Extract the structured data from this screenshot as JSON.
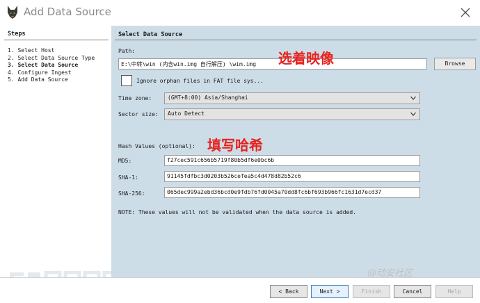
{
  "window": {
    "title": "Add Data Source",
    "close_icon": "close-icon",
    "app_icon": "autopsy-dog-icon"
  },
  "steps": {
    "title": "Steps",
    "items": [
      {
        "label": "1.  Select Host",
        "current": false
      },
      {
        "label": "2.  Select Data Source Type",
        "current": false
      },
      {
        "label": "3.  Select Data Source",
        "current": true
      },
      {
        "label": "4.  Configure Ingest",
        "current": false
      },
      {
        "label": "5.  Add Data Source",
        "current": false
      }
    ]
  },
  "main": {
    "title": "Select Data Source",
    "path_label": "Path:",
    "path_value": "E:\\中转\\win (内含win.img 自行解压) \\wim.img",
    "browse_label": "Browse",
    "ignore_orphan_label": "Ignore orphan files in FAT file sys...",
    "ignore_orphan_checked": false,
    "timezone_label": "Time zone:",
    "timezone_value": "(GMT+8:00) Asia/Shanghai",
    "sector_label": "Sector size:",
    "sector_value": "Auto Detect",
    "hash_label": "Hash Values (optional):",
    "md5_label": "MD5:",
    "md5_value": "f27cec591c656b5719f80b5df6e0bc6b",
    "sha1_label": "SHA-1:",
    "sha1_value": "91145fdfbc3d0203b526cefea5c4d478d82b52c6",
    "sha256_label": "SHA-256:",
    "sha256_value": "065dec999a2ebd36bcd0e9fdb76fd0045a70dd8fc6bf693b966fc1631d7ecd37",
    "note": "NOTE: These values will not be validated when the data source is added.",
    "annotation_select_image": "选着映像",
    "annotation_fill_hash": "填写哈希"
  },
  "footer": {
    "back_label": "< Back",
    "next_label": "Next >",
    "finish_label": "Finish",
    "cancel_label": "Cancel",
    "help_label": "Help",
    "brand_text": "@动安社区"
  },
  "colors": {
    "panel_bg": "#cddde7",
    "annotation": "#e8231f"
  }
}
